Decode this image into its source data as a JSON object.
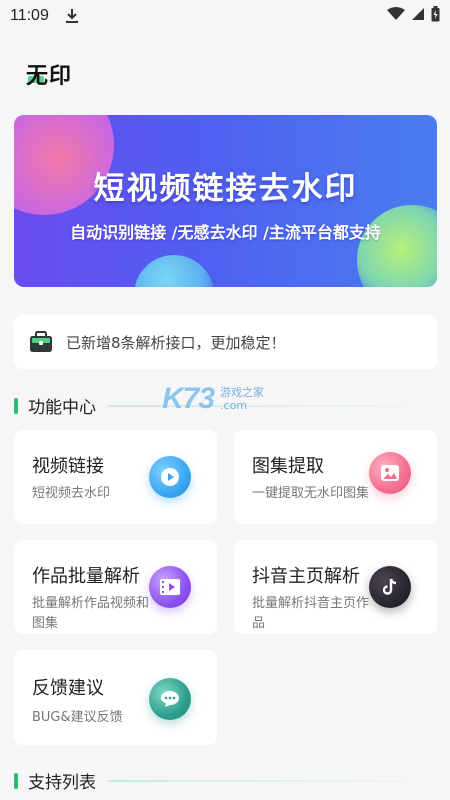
{
  "status_bar": {
    "time": "11:09"
  },
  "app": {
    "title": "无印"
  },
  "banner": {
    "title": "短视频链接去水印",
    "subtitle": "自动识别链接 /无感去水印 /主流平台都支持"
  },
  "notice": {
    "text": "已新增8条解析接口，更加稳定！"
  },
  "sections": {
    "features": "功能中心",
    "supported": "支持列表"
  },
  "watermark": {
    "logo": "K73",
    "line1": "游戏之家",
    "line2": ".com"
  },
  "cards": [
    {
      "title": "视频链接",
      "desc": "短视频去水印",
      "icon": "play-icon",
      "color": "#3aa6f0"
    },
    {
      "title": "图集提取",
      "desc": "一键提取无水印图集",
      "icon": "image-icon",
      "color": "#f26f8e"
    },
    {
      "title": "作品批量解析",
      "desc": "批量解析作品视频和图集",
      "icon": "video-list-icon",
      "color": "#8d52ee"
    },
    {
      "title": "抖音主页解析",
      "desc": "批量解析抖音主页作品",
      "icon": "tiktok-icon",
      "color": "#2a2630"
    },
    {
      "title": "反馈建议",
      "desc": "BUG&建议反馈",
      "icon": "chat-icon",
      "color": "#2e9e8e"
    }
  ]
}
